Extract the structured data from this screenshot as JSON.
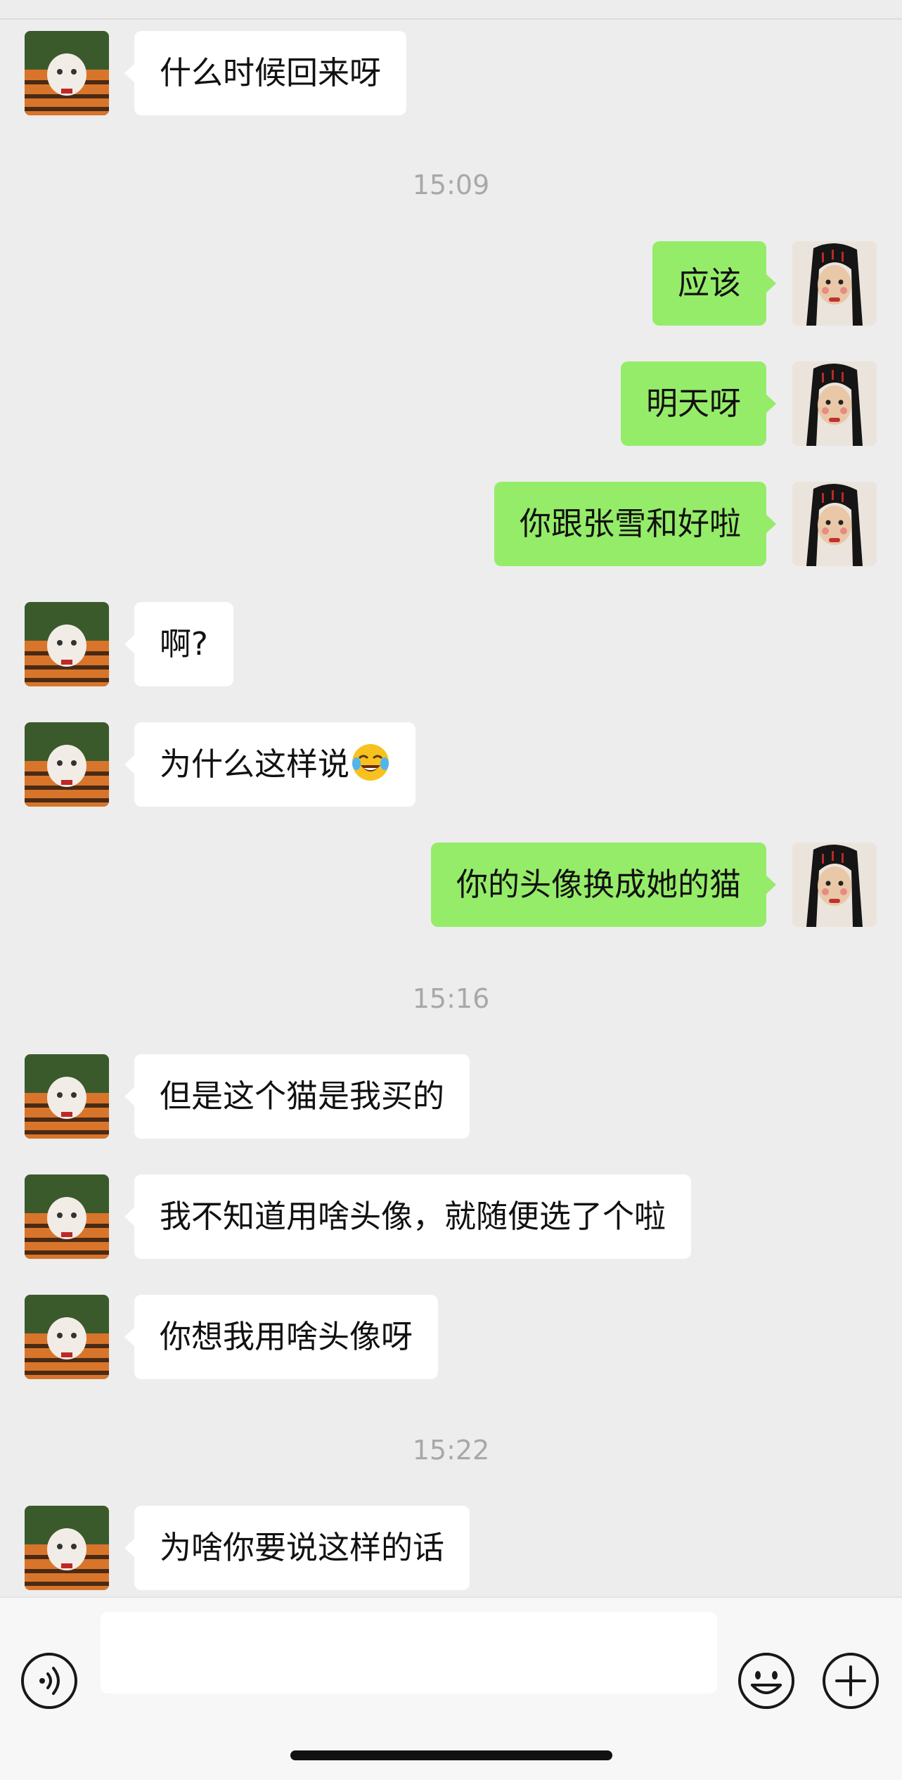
{
  "messages": [
    {
      "side": "left",
      "text": "什么时候回来呀"
    },
    {
      "side": "right",
      "text": "应该"
    },
    {
      "side": "right",
      "text": "明天呀"
    },
    {
      "side": "right",
      "text": "你跟张雪和好啦"
    },
    {
      "side": "left",
      "text": "啊?"
    },
    {
      "side": "left",
      "text": "为什么这样说",
      "emoji": "tears-of-joy-emoji"
    },
    {
      "side": "right",
      "text": "你的头像换成她的猫"
    },
    {
      "side": "left",
      "text": "但是这个猫是我买的"
    },
    {
      "side": "left",
      "text": "我不知道用啥头像，就随便选了个啦"
    },
    {
      "side": "left",
      "text": "你想我用啥头像呀"
    },
    {
      "side": "left",
      "text": "为啥你要说这样的话"
    }
  ],
  "timestamps": [
    "15:09",
    "15:16",
    "15:22"
  ],
  "input": {
    "value": "",
    "placeholder": ""
  },
  "icons": {
    "voice": "voice-input-icon",
    "emoji": "emoji-icon",
    "plus": "plus-icon",
    "avatar_left": "cat-avatar",
    "avatar_right": "girl-avatar"
  },
  "colors": {
    "background": "#ededed",
    "sent_bubble": "#95ec69",
    "received_bubble": "#ffffff",
    "timestamp_text": "#a8a8a8"
  }
}
